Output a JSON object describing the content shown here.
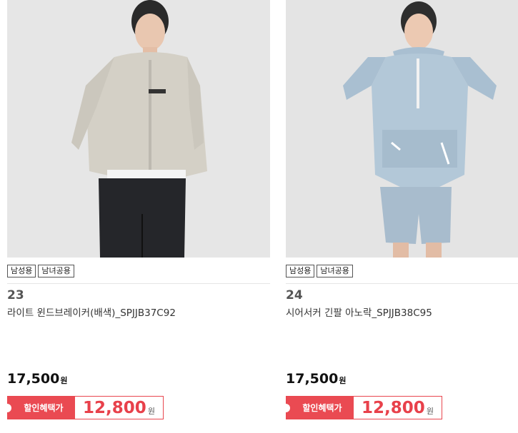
{
  "products": [
    {
      "number": "23",
      "name": "라이트 윈드브레이커(배색)_SPJJB37C92",
      "tags": [
        "남성용",
        "남녀공용"
      ],
      "price": "17,500",
      "currency": "원",
      "discount_label": "할인혜택가",
      "discount_price": "12,800",
      "discount_currency": "원",
      "image": "model-beige-windbreaker"
    },
    {
      "number": "24",
      "name": "시어서커 긴팔 아노락_SPJJB38C95",
      "tags": [
        "남성용",
        "남녀공용"
      ],
      "price": "17,500",
      "currency": "원",
      "discount_label": "할인혜택가",
      "discount_price": "12,800",
      "discount_currency": "원",
      "image": "model-blue-anorak"
    }
  ],
  "colors": {
    "accent": "#ea4a52",
    "price": "#111111",
    "discount_text": "#e8414b"
  }
}
